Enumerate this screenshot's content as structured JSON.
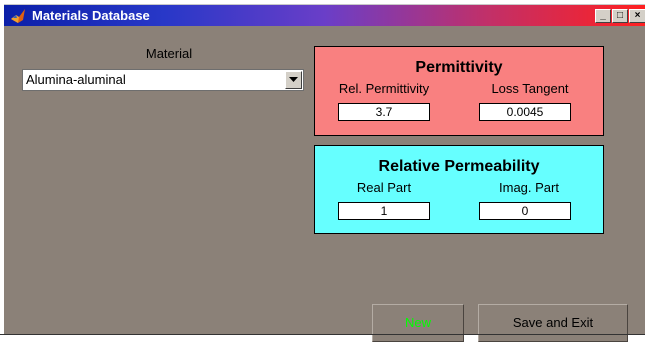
{
  "window": {
    "title": "Materials Database",
    "minimize": "_",
    "maximize": "□",
    "close": "×"
  },
  "material": {
    "label": "Material",
    "selected": "Alumina-aluminal"
  },
  "permittivity": {
    "title": "Permittivity",
    "rel_label": "Rel. Permittivity",
    "loss_label": "Loss Tangent",
    "rel_value": "3.7",
    "loss_value": "0.0045",
    "bg_color": "#f98080"
  },
  "permeability": {
    "title": "Relative Permeability",
    "real_label": "Real Part",
    "imag_label": "Imag. Part",
    "real_value": "1",
    "imag_value": "0",
    "bg_color": "#66ffff"
  },
  "buttons": {
    "new_label": "New",
    "new_color": "#00ff00",
    "save_exit_label": "Save and Exit"
  }
}
